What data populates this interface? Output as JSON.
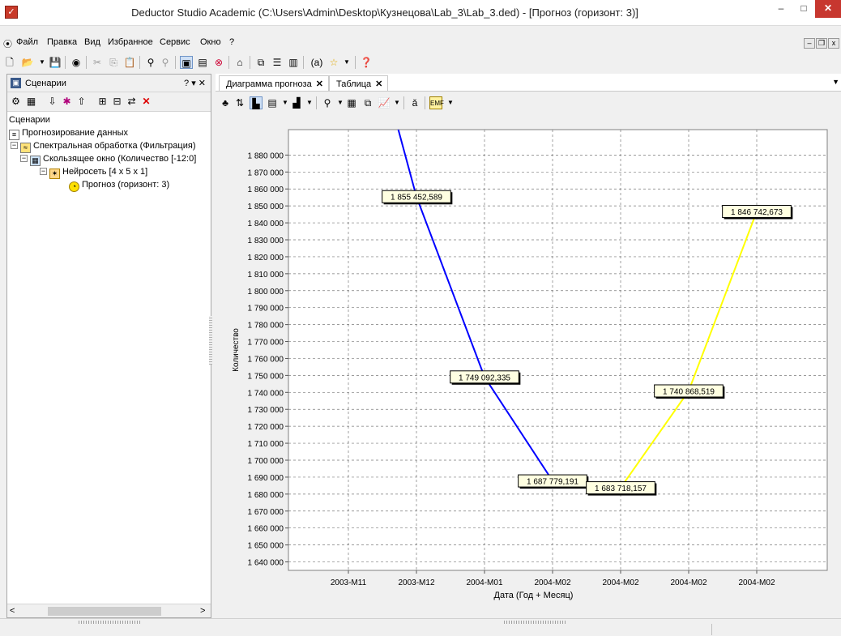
{
  "window": {
    "title": "Deductor Studio Academic (C:\\Users\\Admin\\Desktop\\Кузнецова\\Lab_3\\Lab_3.ded) - [Прогноз (горизонт: 3)]",
    "minimize": "–",
    "maximize": "□",
    "close": "✕"
  },
  "menu": {
    "items": [
      {
        "label": "Файл"
      },
      {
        "label": "Правка"
      },
      {
        "label": "Вид"
      },
      {
        "label": "Избранное"
      },
      {
        "label": "Сервис"
      },
      {
        "label": "Окно"
      },
      {
        "label": "?"
      }
    ],
    "mdi_min": "–",
    "mdi_restore": "❐",
    "mdi_close": "x"
  },
  "scenarios_panel": {
    "title": "Сценарии",
    "controls": "? ▾ ✕",
    "tree": [
      {
        "label": "Сценарии",
        "level": 0,
        "icon": "none"
      },
      {
        "label": "Прогнозирование данных",
        "level": 0,
        "icon": "document-icon"
      },
      {
        "label": "Спектральная обработка (Фильтрация)",
        "level": 0,
        "icon": "spectral-icon",
        "expander": "−"
      },
      {
        "label": "Скользящее окно (Количество [-12:0]",
        "level": 1,
        "icon": "window-icon",
        "expander": "−"
      },
      {
        "label": "Нейросеть [4 x 5 x 1]",
        "level": 2,
        "icon": "neuralnet-icon",
        "expander": "−"
      },
      {
        "label": "Прогноз (горизонт: 3)",
        "level": 3,
        "icon": "forecast-icon"
      }
    ]
  },
  "tabs": [
    {
      "label": "Диаграмма прогноза",
      "close": "✕",
      "active": true
    },
    {
      "label": "Таблица",
      "close": "✕",
      "active": false
    }
  ],
  "tab_dropdown": "▼",
  "chart_data": {
    "type": "line",
    "title": "",
    "xlabel": "Дата (Год + Месяц)",
    "ylabel": "Количество",
    "categories": [
      "2003-M11",
      "2003-M12",
      "2004-M01",
      "2004-M02",
      "2004-M02",
      "2004-M02",
      "2004-M02"
    ],
    "ylim": [
      1635000,
      1895000
    ],
    "yticks": [
      1640000,
      1650000,
      1660000,
      1670000,
      1680000,
      1690000,
      1700000,
      1710000,
      1720000,
      1730000,
      1740000,
      1750000,
      1760000,
      1770000,
      1780000,
      1790000,
      1800000,
      1810000,
      1820000,
      1830000,
      1840000,
      1850000,
      1860000,
      1870000,
      1880000
    ],
    "ytick_labels": [
      "1 640 000",
      "1 650 000",
      "1 660 000",
      "1 670 000",
      "1 680 000",
      "1 690 000",
      "1 700 000",
      "1 710 000",
      "1 720 000",
      "1 730 000",
      "1 740 000",
      "1 750 000",
      "1 760 000",
      "1 770 000",
      "1 780 000",
      "1 790 000",
      "1 800 000",
      "1 810 000",
      "1 820 000",
      "1 830 000",
      "1 840 000",
      "1 850 000",
      "1 860 000",
      "1 870 000",
      "1 880 000"
    ],
    "grid": true,
    "series": [
      {
        "color": "#0000ff",
        "points": [
          {
            "x": 0.7,
            "y": 1900000
          },
          {
            "x": 1,
            "y": 1855452.589
          },
          {
            "x": 2,
            "y": 1749092.335
          },
          {
            "x": 3,
            "y": 1687779.191
          }
        ]
      },
      {
        "color": "#ffff00",
        "points": [
          {
            "x": 3,
            "y": 1687779.191
          },
          {
            "x": 4,
            "y": 1683718.157
          },
          {
            "x": 5,
            "y": 1740868.519
          },
          {
            "x": 6,
            "y": 1846742.673
          }
        ]
      }
    ],
    "data_labels": [
      {
        "text": "1 855 452,589",
        "x": 1,
        "y": 1855452.589
      },
      {
        "text": "1 749 092,335",
        "x": 2,
        "y": 1749092.335
      },
      {
        "text": "1 687 779,191",
        "x": 3,
        "y": 1687779.191
      },
      {
        "text": "1 683 718,157",
        "x": 4,
        "y": 1683718.157
      },
      {
        "text": "1 740 868,519",
        "x": 5,
        "y": 1740868.519
      },
      {
        "text": "1 846 742,673",
        "x": 6,
        "y": 1846742.673
      }
    ]
  }
}
